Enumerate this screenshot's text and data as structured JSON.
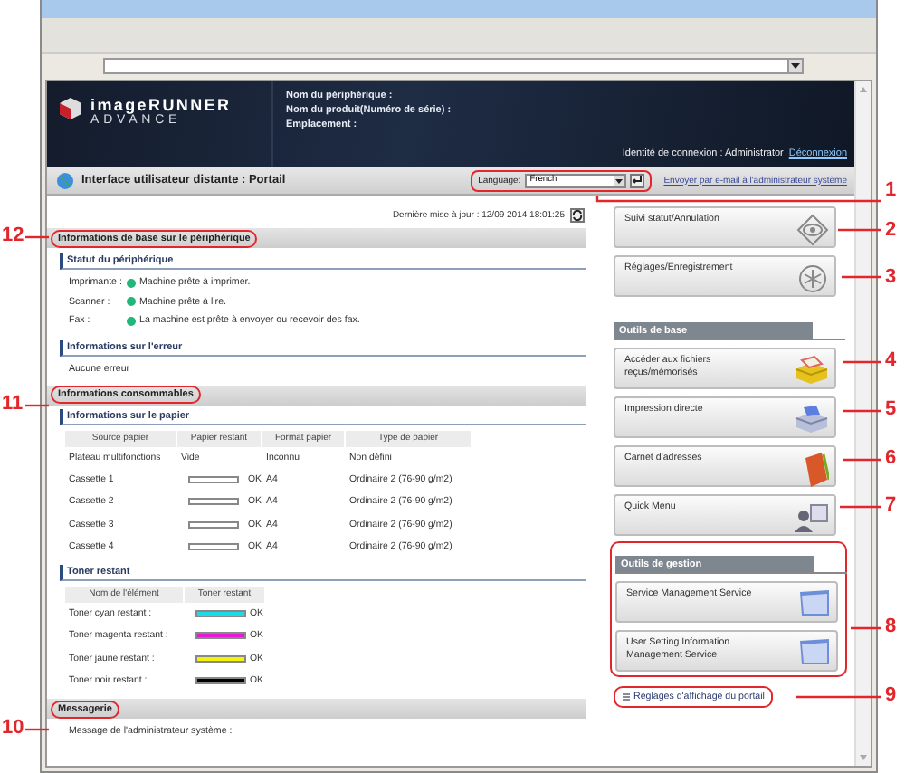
{
  "header": {
    "logo_line1": "imageRUNNER",
    "logo_line2": "ADVANCE",
    "device_fields": [
      "Nom du périphérique :",
      "Nom du produit(Numéro de série) :",
      "Emplacement :"
    ],
    "login_label": "Identité de connexion : Administrator",
    "logout_link": "Déconnexion"
  },
  "title_bar": {
    "title": "Interface utilisateur distante : Portail",
    "language_label": "Language:",
    "language_value": "French",
    "highlighted": true,
    "email_link": "Envoyer par e-mail à l'administrateur système"
  },
  "last_update": "Dernière mise à jour : 12/09 2014 18:01:25",
  "basic_info": {
    "title": "Informations de base sur le périphérique",
    "highlighted": true,
    "device_status": {
      "title": "Statut du périphérique",
      "rows": [
        {
          "label": "Imprimante :",
          "status": "Machine prête à imprimer.",
          "color": "#1fb87a"
        },
        {
          "label": "Scanner :",
          "status": "Machine prête à lire.",
          "color": "#1fb87a"
        },
        {
          "label": "Fax :",
          "status": "La machine est prête à envoyer ou recevoir des fax.",
          "color": "#1fb87a"
        }
      ]
    },
    "error_info": {
      "title": "Informations sur l'erreur",
      "text": "Aucune erreur"
    }
  },
  "consumables": {
    "title": "Informations consommables",
    "highlighted": true,
    "paper": {
      "title": "Informations sur le papier",
      "columns": [
        "Source papier",
        "Papier restant",
        "Format papier",
        "Type de papier"
      ],
      "rows": [
        {
          "kind": "text",
          "source": "Plateau multifonctions",
          "remaining": "Vide",
          "format": "Inconnu",
          "type": "Non défini"
        },
        {
          "kind": "gauge",
          "source": "Cassette 1",
          "remaining": "OK",
          "format": "A4",
          "type": "Ordinaire 2 (76-90 g/m2)"
        },
        {
          "kind": "gauge",
          "source": "Cassette 2",
          "remaining": "OK",
          "format": "A4",
          "type": "Ordinaire 2 (76-90 g/m2)"
        },
        {
          "kind": "gauge",
          "source": "Cassette 3",
          "remaining": "OK",
          "format": "A4",
          "type": "Ordinaire 2 (76-90 g/m2)"
        },
        {
          "kind": "gauge",
          "source": "Cassette 4",
          "remaining": "OK",
          "format": "A4",
          "type": "Ordinaire 2 (76-90 g/m2)"
        }
      ]
    },
    "toner": {
      "title": "Toner restant",
      "columns": [
        "Nom de l'élément",
        "Toner restant"
      ],
      "rows": [
        {
          "name": "Toner cyan restant :",
          "color": "#19dce8",
          "level": 1,
          "remaining": "OK"
        },
        {
          "name": "Toner magenta restant :",
          "color": "#e619d6",
          "level": 1,
          "remaining": "OK"
        },
        {
          "name": "Toner jaune restant :",
          "color": "#f2f20a",
          "level": 1,
          "remaining": "OK"
        },
        {
          "name": "Toner noir restant :",
          "color": "#000000",
          "level": 1,
          "remaining": "OK"
        }
      ]
    }
  },
  "messaging": {
    "title": "Messagerie",
    "highlighted": true,
    "label": "Message de l'administrateur système :"
  },
  "side": {
    "top_buttons": [
      {
        "label": "Suivi statut/Annulation",
        "kind": "status"
      },
      {
        "label": "Réglages/Enregistrement",
        "kind": "settings"
      }
    ],
    "basic_tools": {
      "title": "Outils de base",
      "buttons": [
        {
          "label": "Accéder aux fichiers reçus/mémorisés",
          "kind": "files"
        },
        {
          "label": "Impression directe",
          "kind": "print"
        },
        {
          "label": "Carnet d'adresses",
          "kind": "book"
        },
        {
          "label": "Quick Menu",
          "kind": "quick"
        }
      ]
    },
    "management": {
      "title": "Outils de gestion",
      "highlighted": true,
      "buttons": [
        {
          "label": "Service Management Service",
          "kind": "window"
        },
        {
          "label": "User Setting Information Management Service",
          "kind": "window"
        }
      ]
    },
    "portal_link": {
      "label": "Réglages d'affichage du portail",
      "highlighted": true
    }
  },
  "callouts": [
    {
      "number": "12"
    },
    {
      "number": "11"
    },
    {
      "number": "10"
    },
    {
      "number": "1"
    },
    {
      "number": "2"
    },
    {
      "number": "3"
    },
    {
      "number": "4"
    },
    {
      "number": "5"
    },
    {
      "number": "6"
    },
    {
      "number": "7"
    },
    {
      "number": "8"
    },
    {
      "number": "9"
    }
  ]
}
